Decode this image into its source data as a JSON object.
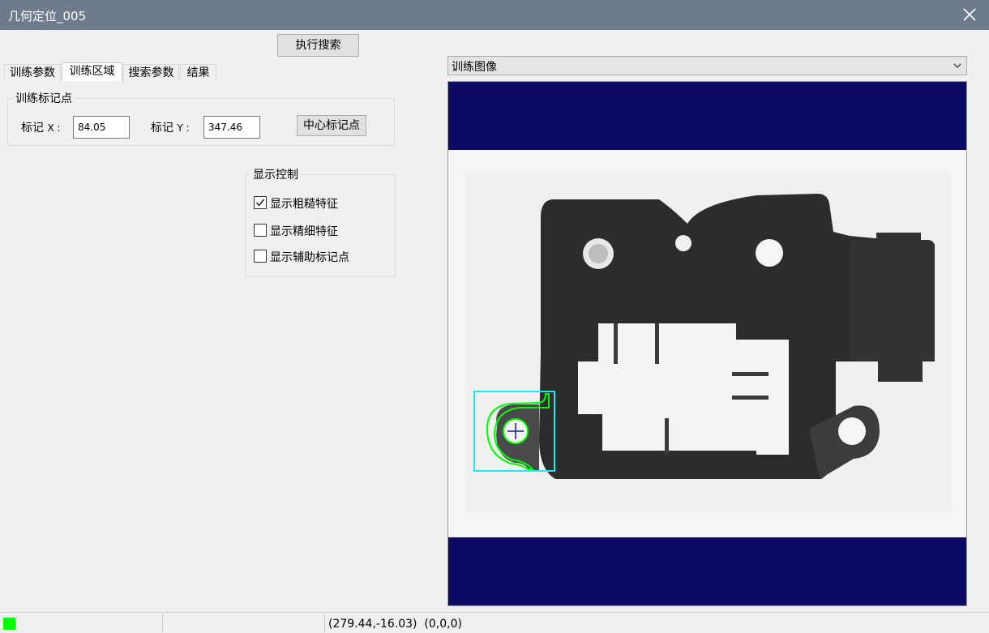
{
  "window": {
    "title": "几何定位_005"
  },
  "toolbar": {
    "execute_label": "执行搜索"
  },
  "tabs": [
    {
      "label": "训练参数",
      "active": false
    },
    {
      "label": "训练区域",
      "active": true
    },
    {
      "label": "搜索参数",
      "active": false
    },
    {
      "label": "结果",
      "active": false
    }
  ],
  "marker_group": {
    "legend": "训练标记点",
    "x_label": "标记",
    "x_axis": "X :",
    "x_value": "84.05",
    "y_label": "标记",
    "y_axis": "Y :",
    "y_value": "347.46",
    "center_button": "中心标记点"
  },
  "display_group": {
    "legend": "显示控制",
    "options": [
      {
        "label": "显示粗糙特征",
        "checked": true
      },
      {
        "label": "显示精细特征",
        "checked": false
      },
      {
        "label": "显示辅助标记点",
        "checked": false
      }
    ]
  },
  "image_select": {
    "value": "训练图像"
  },
  "status": {
    "indicator_color": "#00ff00",
    "coordinates": "(279.44,-16.03)",
    "pixel_value": "(0,0,0)"
  },
  "colors": {
    "titlebar": "#6d7b8d",
    "viewer_background": "#0b0b66",
    "roi_box": "#22e6f0",
    "feature_outline": "#00ff00",
    "marker_cross": "#1a1aa0"
  }
}
